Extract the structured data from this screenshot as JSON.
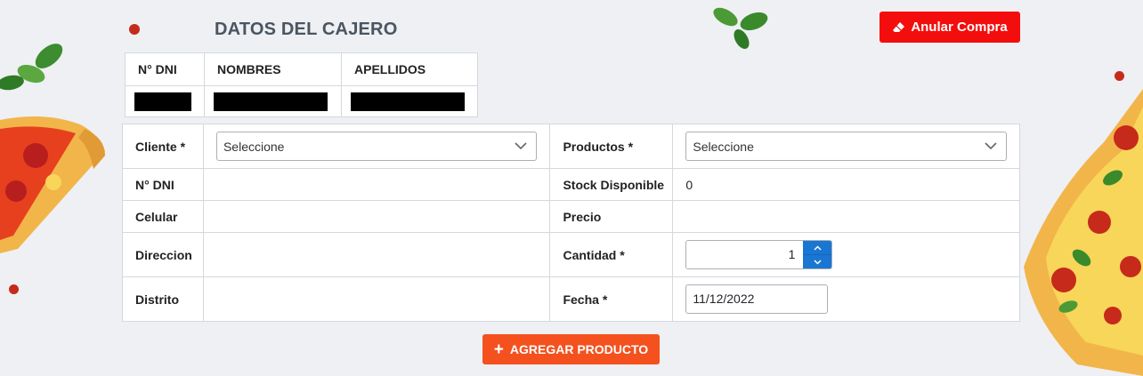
{
  "header": {
    "title": "DATOS DEL CAJERO",
    "cancel_label": "Anular Compra",
    "cancel_icon": "eraser-icon"
  },
  "cashier_table": {
    "columns": [
      "N° DNI",
      "NOMBRES",
      "APELLIDOS"
    ]
  },
  "form": {
    "cliente_label": "Cliente *",
    "cliente_select": "Seleccione",
    "productos_label": "Productos *",
    "productos_select": "Seleccione",
    "dni_label": "N° DNI",
    "dni_value": "",
    "stock_label": "Stock Disponible",
    "stock_value": "0",
    "celular_label": "Celular",
    "celular_value": "",
    "precio_label": "Precio",
    "precio_value": "",
    "direccion_label": "Direccion",
    "direccion_value": "",
    "cantidad_label": "Cantidad *",
    "cantidad_value": "1",
    "distrito_label": "Distrito",
    "distrito_value": "",
    "fecha_label": "Fecha *",
    "fecha_value": "11/12/2022"
  },
  "actions": {
    "add_label": "AGREGAR PRODUCTO",
    "add_icon": "plus-icon"
  },
  "colors": {
    "cancel_button": "#f40d0d",
    "add_button": "#f4511e",
    "stepper_accent": "#1976d2"
  }
}
